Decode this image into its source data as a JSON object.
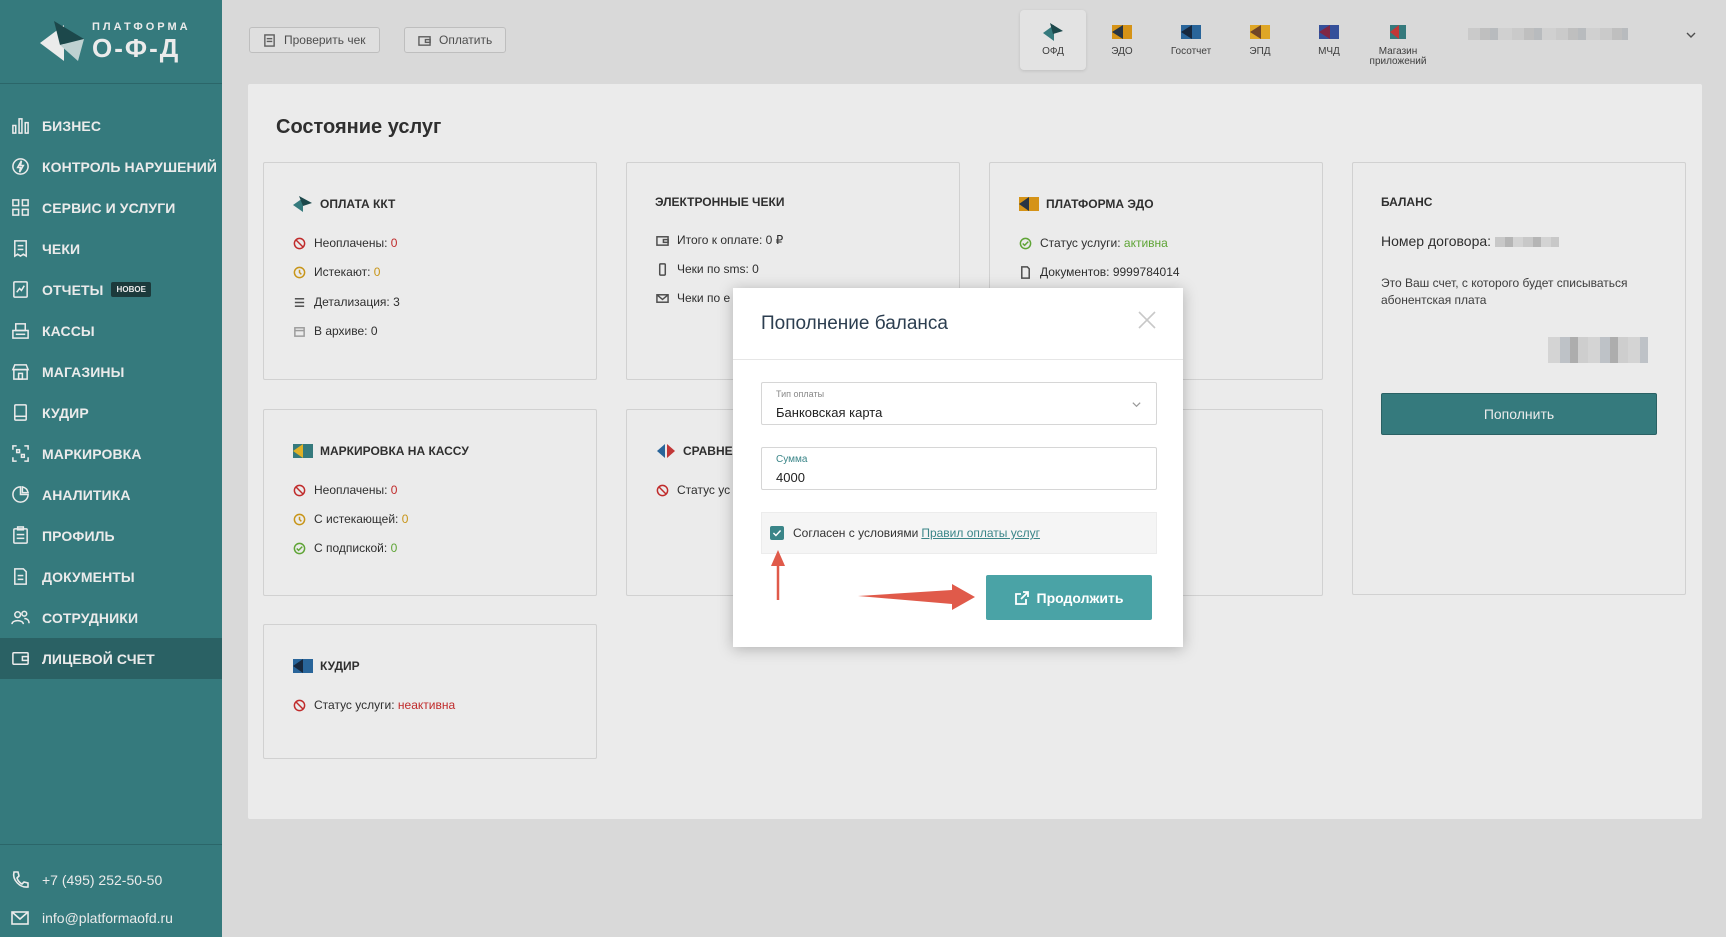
{
  "sidebar": {
    "logo": {
      "small": "ПЛАТФОРМА",
      "big": "О-Ф-Д"
    },
    "items": [
      {
        "label": "Бизнес",
        "icon": "bar-chart-icon"
      },
      {
        "label": "Контроль нарушений",
        "icon": "bolt-icon"
      },
      {
        "label": "Сервис и услуги",
        "icon": "grid-icon"
      },
      {
        "label": "Чеки",
        "icon": "receipt-icon"
      },
      {
        "label": "Отчеты",
        "icon": "report-icon",
        "badge": "НОВОЕ"
      },
      {
        "label": "Кассы",
        "icon": "cash-register-icon"
      },
      {
        "label": "Магазины",
        "icon": "store-icon"
      },
      {
        "label": "КУДиР",
        "icon": "book-icon"
      },
      {
        "label": "Маркировка",
        "icon": "qr-scan-icon"
      },
      {
        "label": "Аналитика",
        "icon": "pie-chart-icon"
      },
      {
        "label": "Профиль",
        "icon": "profile-icon"
      },
      {
        "label": "Документы",
        "icon": "document-icon"
      },
      {
        "label": "Сотрудники",
        "icon": "users-icon"
      },
      {
        "label": "Лицевой счет",
        "icon": "wallet-icon",
        "active": true
      }
    ],
    "phone": "+7 (495) 252-50-50",
    "email": "info@platformaofd.ru"
  },
  "topbar": {
    "check_receipt": "Проверить чек",
    "pay": "Оплатить",
    "apps": [
      {
        "label": "ОФД",
        "active": true
      },
      {
        "label": "ЭДО"
      },
      {
        "label": "Госотчет"
      },
      {
        "label": "ЭПД"
      },
      {
        "label": "МЧД"
      },
      {
        "label": "Магазин приложений"
      }
    ]
  },
  "page": {
    "title": "Состояние услуг"
  },
  "cards": {
    "kkt": {
      "title": "Оплата ККТ",
      "rows": [
        {
          "label": "Неоплачены:",
          "value": "0"
        },
        {
          "label": "Истекают:",
          "value": "0"
        },
        {
          "label": "Детализация:",
          "value": "3"
        },
        {
          "label": "В архиве:",
          "value": "0"
        }
      ]
    },
    "ereceipts": {
      "title": "Электронные чеки",
      "rows": [
        {
          "label": "Итого к оплате:",
          "value": "0 ₽"
        },
        {
          "label": "Чеки по sms:",
          "value": "0"
        },
        {
          "label": "Чеки по e",
          "value": ""
        }
      ]
    },
    "edo": {
      "title": "Платформа ЭДО",
      "rows": [
        {
          "label": "Статус услуги:",
          "value": "активна"
        },
        {
          "label": "Документов:",
          "value": "9999784014"
        }
      ]
    },
    "balance": {
      "title": "Баланс",
      "contract_label": "Номер договора:",
      "note": "Это Ваш счет, с которого будет списываться абонентская плата",
      "button": "Пополнить"
    },
    "marking": {
      "title": "Маркировка на кассу",
      "rows": [
        {
          "label": "Неоплачены:",
          "value": "0"
        },
        {
          "label": "С истекающей:",
          "value": "0"
        },
        {
          "label": "С подпиской:",
          "value": "0"
        }
      ]
    },
    "compare": {
      "title": "Сравне",
      "row": "Статус ус"
    },
    "kudir": {
      "title": "КУДиР",
      "row_label": "Статус услуги:",
      "row_value": "неактивна"
    }
  },
  "modal": {
    "title": "Пополнение баланса",
    "payment_type_label": "Тип оплаты",
    "payment_type_value": "Банковская карта",
    "amount_label": "Сумма",
    "amount_value": "4000",
    "agree_text": "Согласен с условиями",
    "agree_link": "Правил оплаты услуг",
    "agree_checked": true,
    "continue_button": "Продолжить"
  },
  "colors": {
    "brand": "#3a8588",
    "button": "#4aa3a6",
    "red": "#d12f2f",
    "orange": "#d9a21b",
    "green": "#67b23a",
    "arrow": "#e05a4a"
  }
}
